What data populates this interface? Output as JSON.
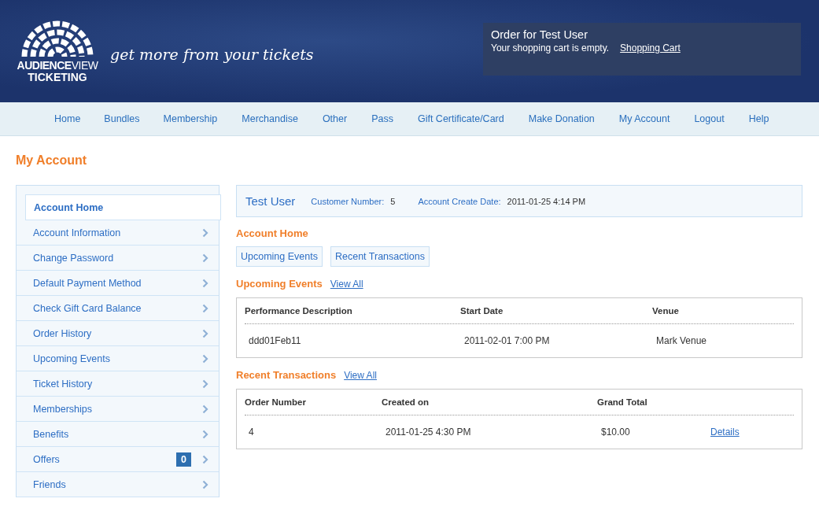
{
  "header": {
    "logo": {
      "line1": "**AUDIENCE**VIEW",
      "line2": "TICKETING"
    },
    "tagline": "get more from your tickets",
    "order_box": {
      "title": "Order for Test User",
      "message": "Your shopping cart is empty.",
      "cart_link": "Shopping Cart"
    }
  },
  "nav": [
    "Home",
    "Bundles",
    "Membership",
    "Merchandise",
    "Other",
    "Pass",
    "Gift Certificate/Card",
    "Make Donation",
    "My Account",
    "Logout",
    "Help"
  ],
  "page_title": "My Account",
  "sidebar": {
    "items": [
      {
        "label": "Account Home",
        "selected": true
      },
      {
        "label": "Account Information",
        "selected": false
      },
      {
        "label": "Change Password",
        "selected": false
      },
      {
        "label": "Default Payment Method",
        "selected": false
      },
      {
        "label": "Check Gift Card Balance",
        "selected": false
      },
      {
        "label": "Order History",
        "selected": false
      },
      {
        "label": "Upcoming Events",
        "selected": false
      },
      {
        "label": "Ticket History",
        "selected": false
      },
      {
        "label": "Memberships",
        "selected": false
      },
      {
        "label": "Benefits",
        "selected": false
      },
      {
        "label": "Offers",
        "selected": false,
        "badge": "0"
      },
      {
        "label": "Friends",
        "selected": false
      }
    ]
  },
  "account": {
    "name": "Test User",
    "customer_number_label": "Customer Number:",
    "customer_number": "5",
    "create_date_label": "Account Create Date:",
    "create_date": "2011-01-25 4:14 PM"
  },
  "section_title": "Account Home",
  "section_tabs": [
    "Upcoming Events",
    "Recent Transactions"
  ],
  "upcoming": {
    "title": "Upcoming Events",
    "view_all": "View All",
    "columns": [
      "Performance Description",
      "Start Date",
      "Venue"
    ],
    "rows": [
      [
        "ddd01Feb11",
        "2011-02-01 7:00 PM",
        "Mark Venue"
      ]
    ]
  },
  "transactions": {
    "title": "Recent Transactions",
    "view_all": "View All",
    "columns": [
      "Order Number",
      "Created on",
      "Grand Total"
    ],
    "rows": [
      {
        "cells": [
          "4",
          "2011-01-25 4:30 PM",
          "$10.00"
        ],
        "link": "Details"
      }
    ]
  }
}
